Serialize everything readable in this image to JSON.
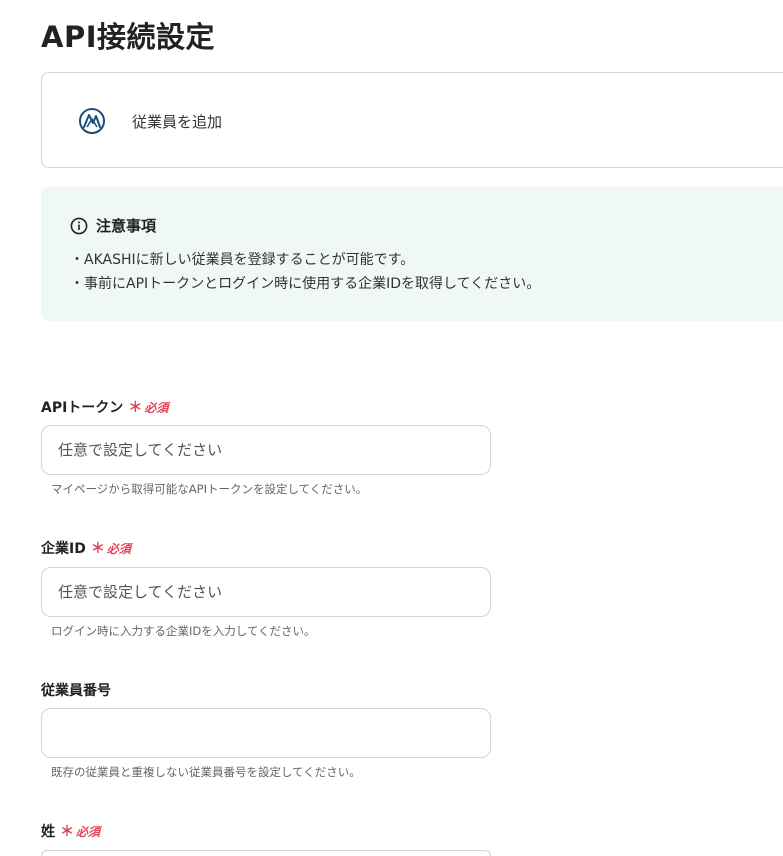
{
  "page": {
    "title": "API接続設定"
  },
  "action": {
    "app_icon": "akashi-logo-icon",
    "label": "従業員を追加"
  },
  "notice": {
    "icon": "info-icon",
    "title": "注意事項",
    "lines": [
      "・AKASHIに新しい従業員を登録することが可能です。",
      "・事前にAPIトークンとログイン時に使用する企業IDを取得してください。"
    ]
  },
  "fields": [
    {
      "label": "APIトークン",
      "required_mark": "＊",
      "required_text": "必須",
      "placeholder": "任意で設定してください",
      "value": "",
      "help": "マイページから取得可能なAPIトークンを設定してください。"
    },
    {
      "label": "企業ID",
      "required_mark": "＊",
      "required_text": "必須",
      "placeholder": "任意で設定してください",
      "value": "",
      "help": "ログイン時に入力する企業IDを入力してください。"
    },
    {
      "label": "従業員番号",
      "placeholder": "",
      "value": "",
      "help": "既存の従業員と重複しない従業員番号を設定してください。"
    },
    {
      "label": "姓",
      "required_mark": "＊",
      "required_text": "必須",
      "placeholder": "",
      "value": ""
    }
  ],
  "colors": {
    "required": "#e0455a",
    "notice_bg": "#eff8f7",
    "border": "#cfd4d9",
    "logo": "#1f4e79"
  }
}
